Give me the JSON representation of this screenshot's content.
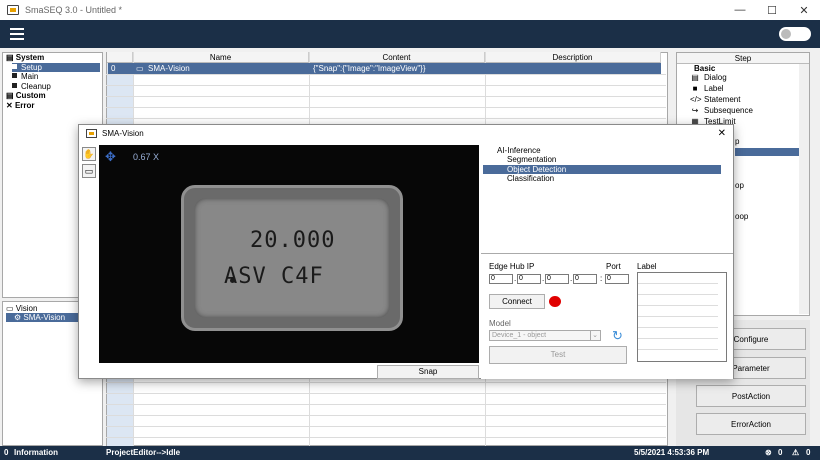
{
  "window": {
    "title": "SmaSEQ 3.0 - Untitled *",
    "minimize": "—",
    "maximize": "☐",
    "close": "✕"
  },
  "tree": {
    "items": [
      {
        "label": "System",
        "bold": true,
        "indent": 0,
        "selected": false
      },
      {
        "label": "Setup",
        "bold": false,
        "indent": 1,
        "selected": true
      },
      {
        "label": "Main",
        "bold": false,
        "indent": 1,
        "selected": false
      },
      {
        "label": "Cleanup",
        "bold": false,
        "indent": 1,
        "selected": false
      },
      {
        "label": "Custom",
        "bold": true,
        "indent": 0,
        "selected": false
      },
      {
        "label": "Error",
        "bold": true,
        "indent": 0,
        "selected": false
      }
    ]
  },
  "vision_panel": {
    "root": "Vision",
    "child": "SMA-Vision"
  },
  "grid": {
    "columns": [
      "Name",
      "Content",
      "Description"
    ],
    "row": {
      "index": "0",
      "name": "SMA-Vision",
      "content": "{\"Snap\":{\"Image\":\"ImageView\"}}",
      "description": ""
    }
  },
  "steps": {
    "header": "Step",
    "group": "Basic",
    "items": [
      {
        "icon": "▤",
        "label": "Dialog"
      },
      {
        "icon": "■",
        "label": "Label"
      },
      {
        "icon": "</>",
        "label": "Statement"
      },
      {
        "icon": "↪",
        "label": "Subsequence"
      },
      {
        "icon": "▦",
        "label": "TestLimit"
      }
    ],
    "partial": [
      "p",
      "op",
      "oop"
    ]
  },
  "side_buttons": {
    "configure": "Configure",
    "parameter": "Parameter",
    "postaction": "PostAction",
    "erroraction": "ErrorAction"
  },
  "status": {
    "info": "Information",
    "info_count": "0",
    "editor": "ProjectEditor-->Idle",
    "datetime": "5/5/2021 4:53:36 PM",
    "errors": "0",
    "warnings": "0"
  },
  "dialog": {
    "title": "SMA-Vision",
    "close": "✕",
    "zoom": "0.67 X",
    "chip_line1": "20.000",
    "chip_line2": "ASV  C4F",
    "snap": "Snap",
    "ai_tree": {
      "root": "AI-Inference",
      "items": [
        "Segmentation",
        "Object Detection",
        "Classification"
      ],
      "selected": "Object Detection"
    },
    "edge_hub_label": "Edge Hub IP",
    "port_label": "Port",
    "label_label": "Label",
    "ip": [
      "0",
      "0",
      "0",
      "0"
    ],
    "port": "0",
    "connect": "Connect",
    "model_label": "Model",
    "model_value": "Device_1 - object",
    "test": "Test",
    "status_color": "#e00000"
  }
}
